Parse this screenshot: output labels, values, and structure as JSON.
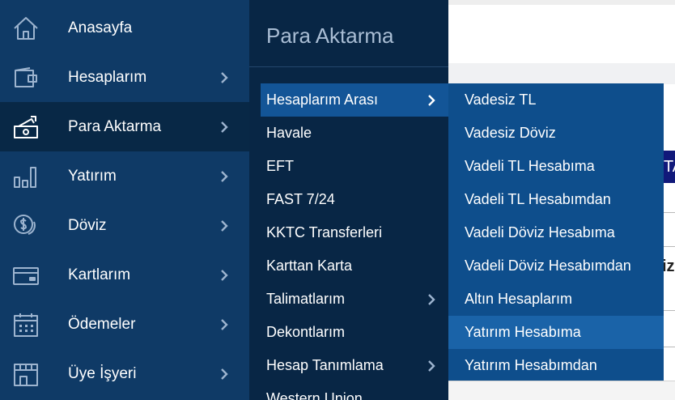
{
  "background": {
    "fragment_blue": "TA",
    "fragment_text": "iz:"
  },
  "sidebar": {
    "items": [
      {
        "label": "Anasayfa",
        "icon": "home-icon",
        "chevron": false,
        "active": false
      },
      {
        "label": "Hesaplarım",
        "icon": "wallet-icon",
        "chevron": true,
        "active": false
      },
      {
        "label": "Para Aktarma",
        "icon": "money-transfer-icon",
        "chevron": true,
        "active": true
      },
      {
        "label": "Yatırım",
        "icon": "investment-chart-icon",
        "chevron": true,
        "active": false
      },
      {
        "label": "Döviz",
        "icon": "currency-coins-icon",
        "chevron": true,
        "active": false
      },
      {
        "label": "Kartlarım",
        "icon": "card-icon",
        "chevron": true,
        "active": false
      },
      {
        "label": "Ödemeler",
        "icon": "calendar-icon",
        "chevron": true,
        "active": false
      },
      {
        "label": "Üye İşyeri",
        "icon": "store-icon",
        "chevron": true,
        "active": false
      }
    ]
  },
  "submenu": {
    "title": "Para Aktarma",
    "items": [
      {
        "label": "Hesaplarım Arası",
        "chevron": true,
        "active": true
      },
      {
        "label": "Havale",
        "chevron": false
      },
      {
        "label": "EFT",
        "chevron": false
      },
      {
        "label": "FAST 7/24",
        "chevron": false
      },
      {
        "label": "KKTC Transferleri",
        "chevron": false
      },
      {
        "label": "Karttan Karta",
        "chevron": false
      },
      {
        "label": "Talimatlarım",
        "chevron": true
      },
      {
        "label": "Dekontlarım",
        "chevron": false
      },
      {
        "label": "Hesap Tanımlama",
        "chevron": true
      },
      {
        "label": "Western Union",
        "chevron": false
      }
    ]
  },
  "flyout": {
    "items": [
      {
        "label": "Vadesiz TL"
      },
      {
        "label": "Vadesiz Döviz"
      },
      {
        "label": "Vadeli TL Hesabıma"
      },
      {
        "label": "Vadeli TL Hesabımdan"
      },
      {
        "label": "Vadeli Döviz Hesabıma"
      },
      {
        "label": "Vadeli Döviz Hesabımdan"
      },
      {
        "label": "Altın Hesaplarım"
      },
      {
        "label": "Yatırım Hesabıma",
        "hover": true
      },
      {
        "label": "Yatırım Hesabımdan"
      }
    ]
  },
  "colors": {
    "sidebar_bg": "#0f3a66",
    "sidebar_active": "#082846",
    "submenu_bg": "#082645",
    "submenu_active": "#135597",
    "flyout_bg": "#0e4e8c",
    "flyout_hover": "#1a63a8",
    "icon_stroke": "#9db4cf"
  }
}
